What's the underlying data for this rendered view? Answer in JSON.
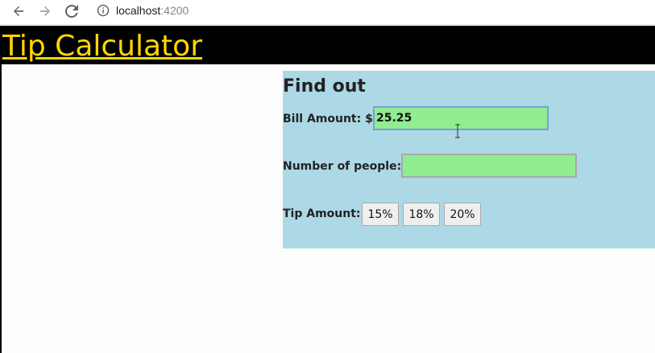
{
  "browser": {
    "back_icon": "arrow-left-icon",
    "forward_icon": "arrow-right-icon",
    "reload_icon": "reload-icon",
    "info_icon": "info-icon",
    "address_host": "localhost",
    "address_port": ":4200"
  },
  "app": {
    "title": "Tip Calculator",
    "title_color": "#ffd700",
    "header_color": "#000000"
  },
  "panel": {
    "background": "#add8e6",
    "heading": "Find out",
    "bill_label": "Bill Amount: $",
    "bill_value": "25.25",
    "people_label": "Number of people:",
    "people_value": "",
    "tip_label": "Tip Amount:",
    "tip_options": [
      "15%",
      "18%",
      "20%"
    ],
    "input_color": "#90ee90"
  }
}
